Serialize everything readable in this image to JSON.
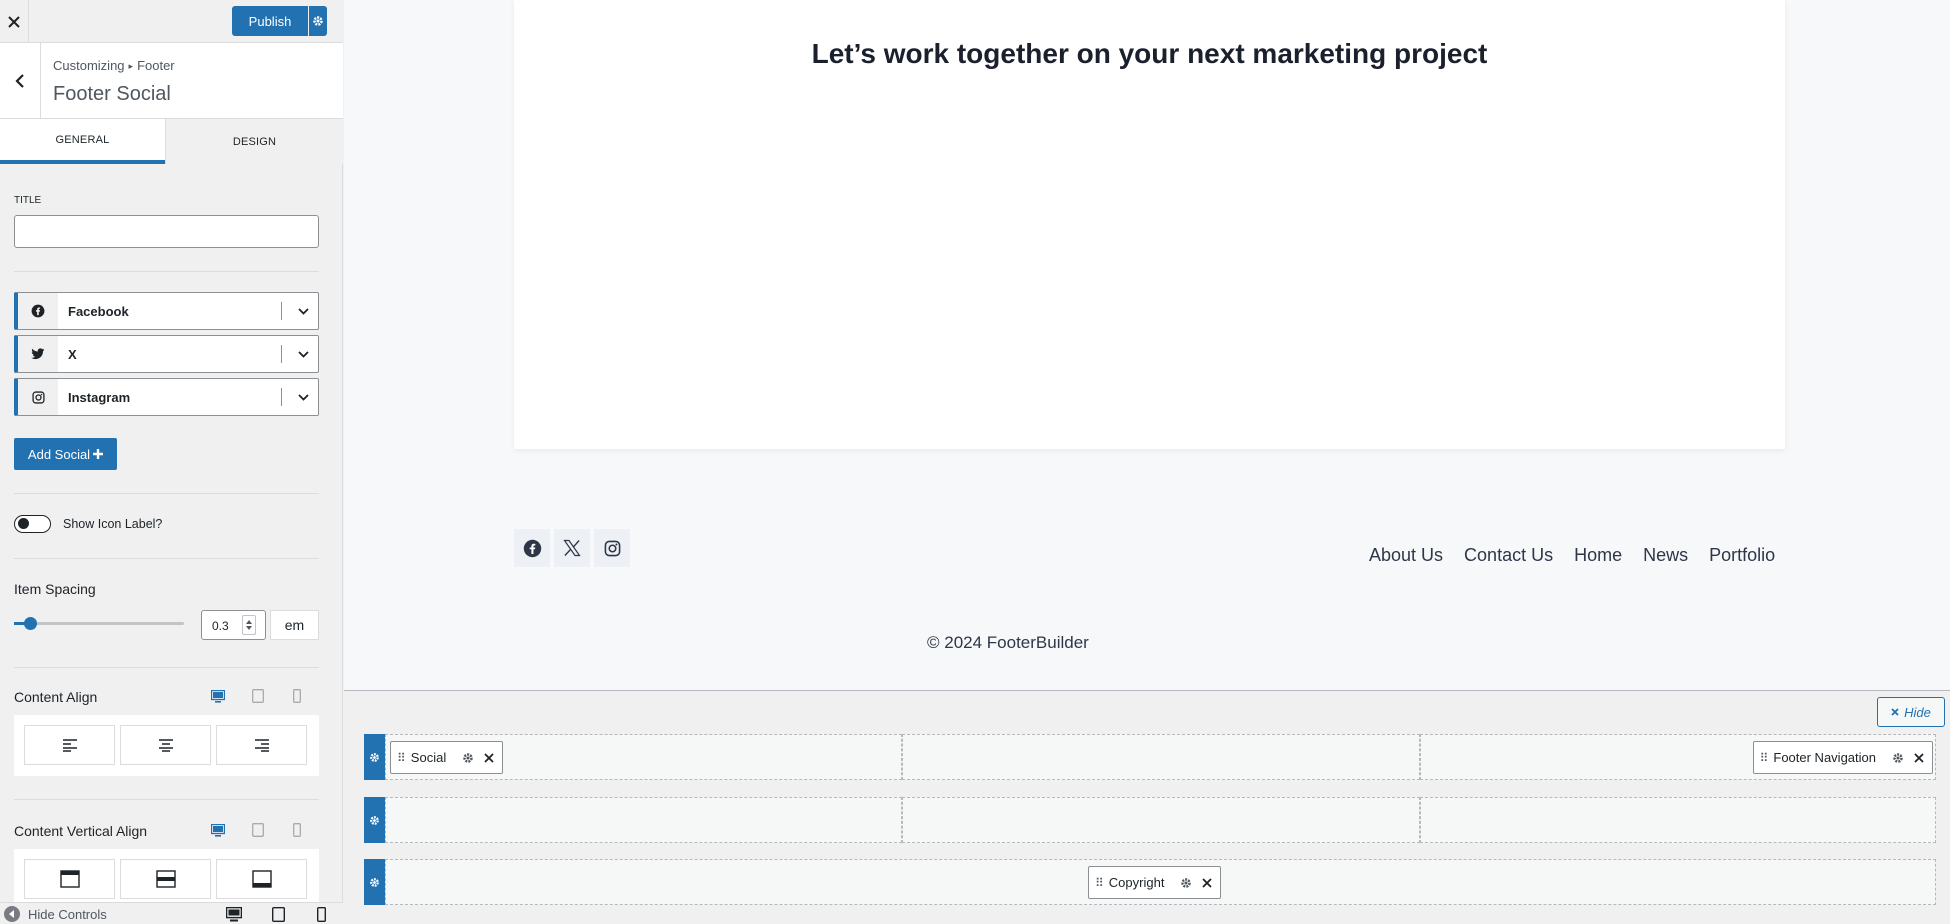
{
  "header": {
    "publish_label": "Publish",
    "breadcrumb_root": "Customizing",
    "breadcrumb_parent": "Footer",
    "section_title": "Footer Social"
  },
  "tabs": {
    "general": "General",
    "design": "Design"
  },
  "general": {
    "title_label": "TITLE",
    "title_value": "",
    "socials": [
      {
        "name": "Facebook",
        "icon": "facebook-icon"
      },
      {
        "name": "X",
        "icon": "x-twitter-icon"
      },
      {
        "name": "Instagram",
        "icon": "instagram-icon"
      }
    ],
    "add_social_label": "Add Social",
    "show_icon_label": "Show Icon Label?",
    "show_icon_label_on": false,
    "item_spacing_title": "Item Spacing",
    "item_spacing_value": "0.3",
    "item_spacing_unit": "em",
    "content_align_title": "Content Align",
    "content_vertical_align_title": "Content Vertical Align",
    "hide_controls_label": "Hide Controls"
  },
  "preview": {
    "hero_title": "Let’s work together on your next marketing project",
    "footer_nav": [
      "About Us",
      "Contact Us",
      "Home",
      "News",
      "Portfolio"
    ],
    "copyright": "© 2024 FooterBuilder"
  },
  "builder": {
    "hide_label": "Hide",
    "social_chip": "Social",
    "nav_chip": "Footer Navigation",
    "copyright_chip": "Copyright"
  },
  "colors": {
    "accent": "#2271b1",
    "text": "#1d2327",
    "preview_bg": "#f7f8fa"
  }
}
